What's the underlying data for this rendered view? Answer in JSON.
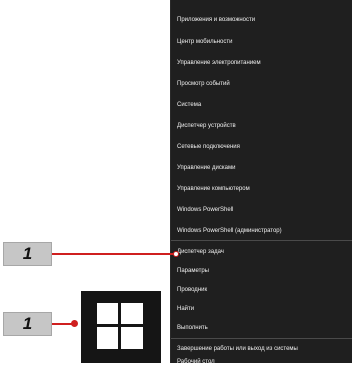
{
  "menu": {
    "items": [
      {
        "label": "Приложения и возможности"
      },
      {
        "label": "Центр мобильности"
      },
      {
        "label": "Управление электропитанием"
      },
      {
        "label": "Просмотр событий"
      },
      {
        "label": "Система"
      },
      {
        "label": "Диспетчер устройств"
      },
      {
        "label": "Сетевые подключения"
      },
      {
        "label": "Управление дисками"
      },
      {
        "label": "Управление компьютером"
      },
      {
        "label": "Windows PowerShell"
      },
      {
        "label": "Windows PowerShell (администратор)"
      },
      {
        "label": "Диспетчер задач"
      },
      {
        "label": "Параметры"
      },
      {
        "label": "Проводник"
      },
      {
        "label": "Найти"
      },
      {
        "label": "Выполнить"
      },
      {
        "label": "Завершение работы или выход из системы"
      },
      {
        "label": "Рабочий стол"
      }
    ]
  },
  "callouts": [
    {
      "number": "1",
      "target": "Параметры"
    },
    {
      "number": "1",
      "target": "start-button"
    }
  ],
  "colors": {
    "menu_background": "#1f1f1f",
    "callout_fill": "#c6c6c6",
    "leader_line": "#cf1f1f",
    "start_tile": "#151515"
  },
  "icons": [
    "windows-logo-icon"
  ]
}
